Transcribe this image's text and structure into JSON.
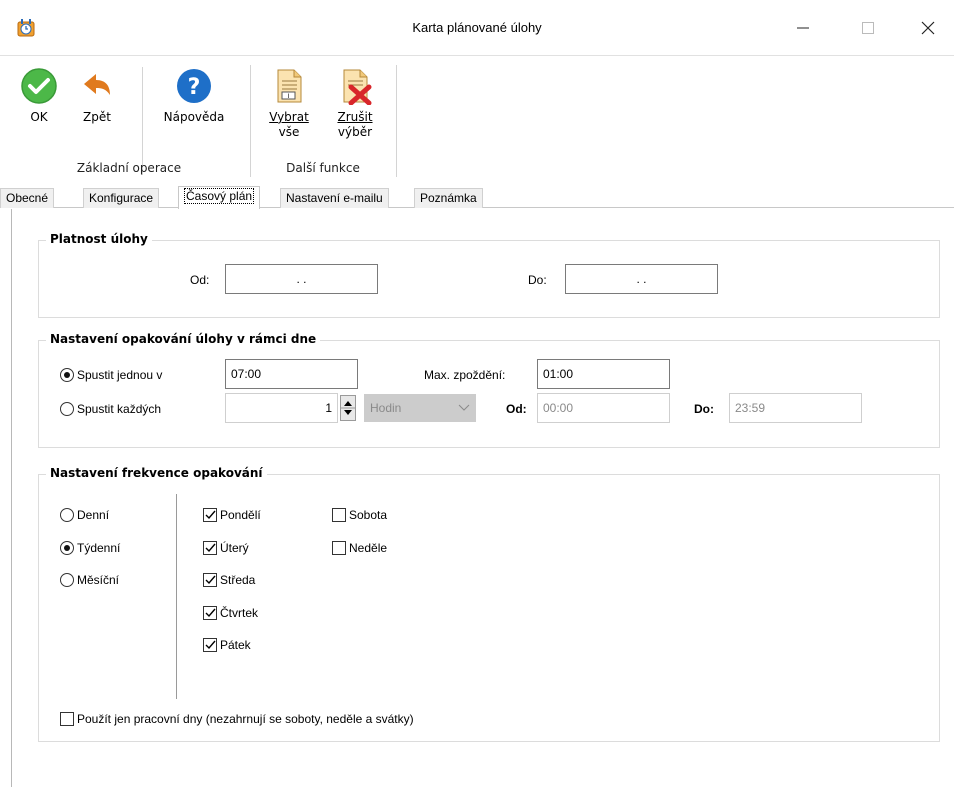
{
  "window": {
    "title": "Karta plánované úlohy",
    "controls": [
      "—",
      "☐",
      "✕"
    ]
  },
  "ribbon": {
    "ok_label": "OK",
    "back_label": "Zpět",
    "help_label": "Nápověda",
    "select_all_line1": "Vybrat",
    "select_all_line2": "vše",
    "cancel_sel_line1": "Zrušit",
    "cancel_sel_line2": "výběr",
    "group_basic": "Základní operace",
    "group_more": "Další funkce"
  },
  "tabs": [
    "Obecné",
    "Konfigurace",
    "Časový plán",
    "Nastavení e-mailu",
    "Poznámka"
  ],
  "validity": {
    "title": "Platnost úlohy",
    "from_label": "Od:",
    "from_value": ". .",
    "to_label": "Do:",
    "to_value": ". ."
  },
  "repeat_day": {
    "title": "Nastavení opakování úlohy v rámci dne",
    "run_once_label": "Spustit jednou v",
    "run_once_value": "07:00",
    "max_delay_label": "Max. zpoždění:",
    "max_delay_value": "01:00",
    "run_every_label": "Spustit každých",
    "every_count": "1",
    "every_unit": "Hodin",
    "from_label": "Od:",
    "from_value": "00:00",
    "to_label": "Do:",
    "to_value": "23:59"
  },
  "frequency": {
    "title": "Nastavení frekvence opakování",
    "modes": [
      "Denní",
      "Týdenní",
      "Měsíční"
    ],
    "selected_mode": "Týdenní",
    "days_left": [
      "Pondělí",
      "Úterý",
      "Středa",
      "Čtvrtek",
      "Pátek"
    ],
    "days_right": [
      "Sobota",
      "Neděle"
    ],
    "workdays_only_label": "Použít jen pracovní dny (nezahrnují se soboty, neděle a svátky)"
  },
  "colors": {
    "ok_green": "#4cb848",
    "back_orange": "#e07a1e",
    "help_blue": "#1e6fc8",
    "cancel_red": "#d8262a"
  }
}
